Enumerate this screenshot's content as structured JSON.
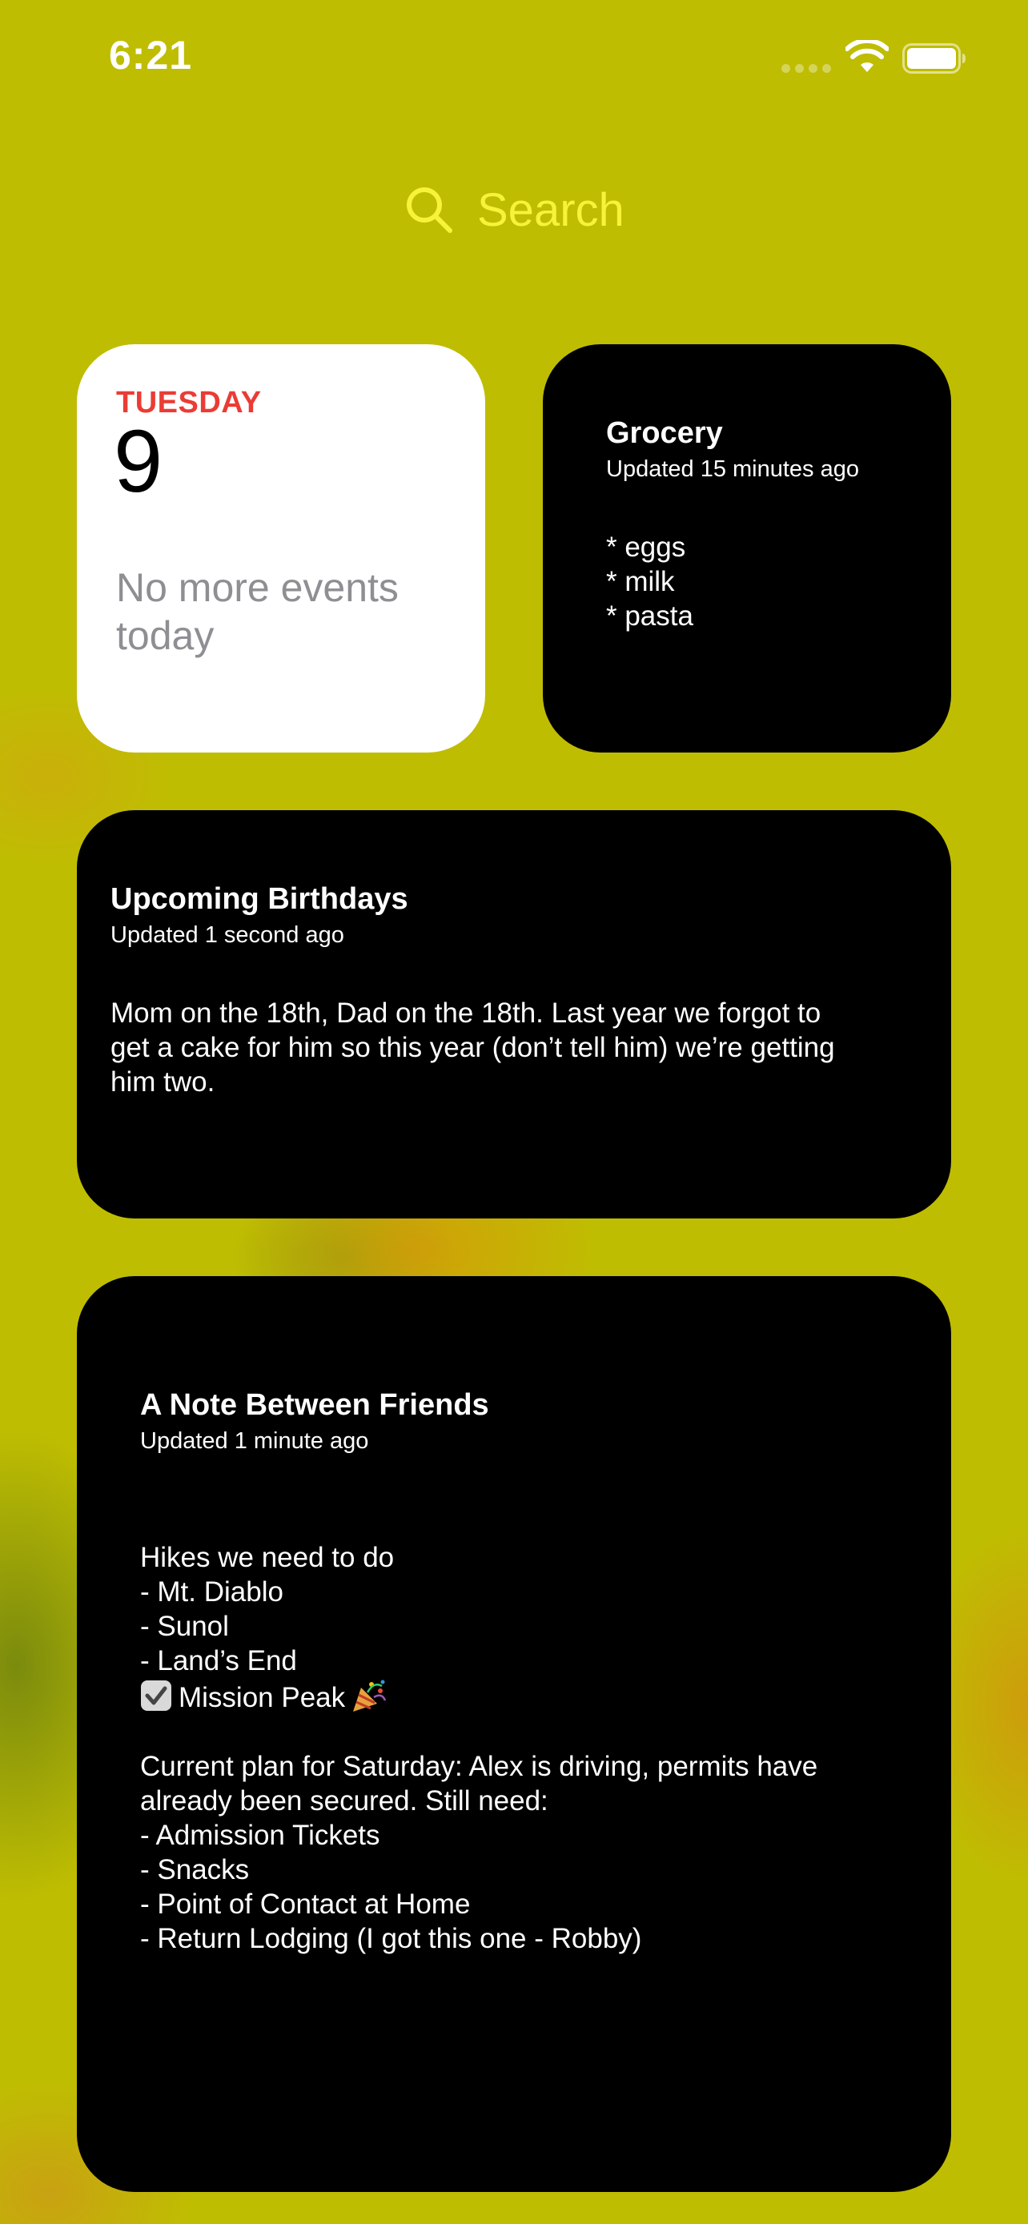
{
  "status_bar": {
    "time": "6:21",
    "icons": [
      "signal-dots-icon",
      "wifi-icon",
      "battery-icon"
    ]
  },
  "search": {
    "label": "Search",
    "icon": "search-icon",
    "color": "#f7f23a"
  },
  "calendar_widget": {
    "day": "TUESDAY",
    "date": "9",
    "message": "No more events today",
    "accent": "#ea3c35"
  },
  "grocery_widget": {
    "title": "Grocery",
    "updated": "Updated 15 minutes ago",
    "lines": [
      "* eggs",
      "* milk",
      "* pasta"
    ]
  },
  "birthdays_widget": {
    "title": "Upcoming Birthdays",
    "updated": "Updated 1 second ago",
    "lines": [
      "Mom on the 18th, Dad on the 18th. Last year we forgot to",
      "get a cake for him so this year (don’t tell him) we’re getting",
      "him two."
    ]
  },
  "note_widget": {
    "title": "A Note Between Friends",
    "updated": "Updated 1 minute ago",
    "lines": [
      "Hikes we need to do",
      "- Mt. Diablo",
      "- Sunol",
      "- Land’s End",
      "Mission Peak",
      "",
      "Current plan for Saturday: Alex is driving, permits have",
      "already been secured. Still need:",
      "- Admission Tickets",
      "- Snacks",
      "- Point of Contact at Home",
      "- Return Lodging (I got this one - Robby)"
    ]
  },
  "colors": {
    "wallpaper": "#bfbd02",
    "widget_dark": "#000000",
    "widget_light": "#ffffff",
    "secondary_text": "#8e8e93"
  }
}
